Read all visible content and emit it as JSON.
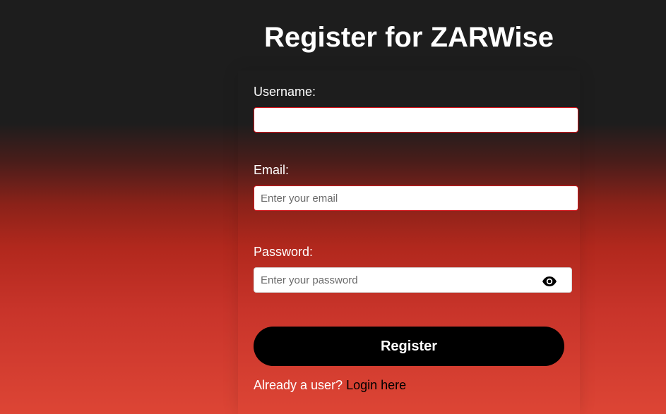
{
  "page": {
    "title": "Register for ZARWise"
  },
  "form": {
    "username": {
      "label": "Username:",
      "value": "",
      "placeholder": ""
    },
    "email": {
      "label": "Email:",
      "value": "",
      "placeholder": "Enter your email"
    },
    "password": {
      "label": "Password:",
      "value": "",
      "placeholder": "Enter your password",
      "toggle_icon": "eye-icon"
    },
    "submit_label": "Register",
    "login_prompt": "Already a user?",
    "login_link": "Login here"
  },
  "colors": {
    "background_top": "#1d1d1d",
    "background_bottom": "#dd4535",
    "field_border_invalid": "#d4141b",
    "button_bg": "#000000",
    "text": "#ffffff",
    "link": "#000000"
  }
}
